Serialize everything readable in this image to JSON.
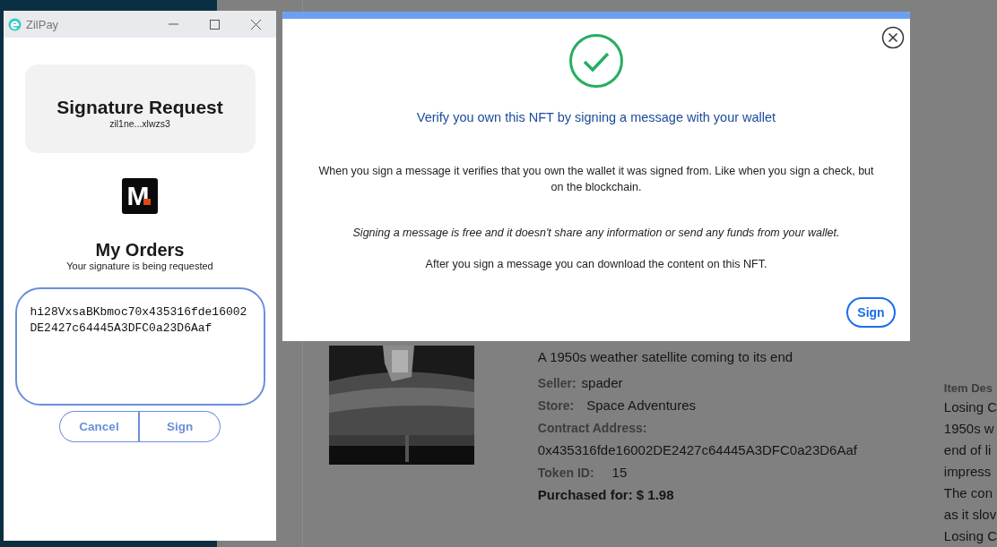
{
  "wallet_window": {
    "title": "ZilPay",
    "header_title": "Signature Request",
    "account": "zil1ne...xlwzs3",
    "logo_letter": "M",
    "app_name": "My Orders",
    "subtitle": "Your signature is being requested",
    "message": "hi28VxsaBKbmoc70x435316fde16002DE2427c64445A3DFC0a23D6Aaf",
    "buttons": [
      {
        "label": "Cancel",
        "kind": "cancel"
      },
      {
        "label": "Sign",
        "kind": "sign"
      }
    ]
  },
  "modal": {
    "title": "Verify you own this NFT by signing a message with your wallet",
    "paragraphs": [
      {
        "text": "When you sign a message it verifies that you own the wallet it was signed from. Like when you sign a check, but on the blockchain.",
        "kind": "normal"
      },
      {
        "text": "Signing a message is free and it doesn't share any information or send any funds from your wallet.",
        "kind": "italic"
      },
      {
        "text": "After you sign a message you can download the content on this NFT.",
        "kind": "normal"
      }
    ],
    "button": "Sign"
  },
  "page": {
    "tagline": "A 1950s weather satellite coming to its end",
    "details": [
      {
        "label": "Seller:",
        "value": "spader",
        "kind": "inline"
      },
      {
        "label": "Store:",
        "value": "Space Adventures",
        "kind": "inline"
      },
      {
        "label": "Contract Address:",
        "value": "0x435316fde16002DE2427c64445A3DFC0a23D6Aaf",
        "kind": "stacked"
      },
      {
        "label": "Token ID:",
        "value": "15",
        "kind": "inline"
      }
    ],
    "purchased": "Purchased for: $ 1.98",
    "description_label": "Item Des",
    "description_lines": [
      "Losing C",
      "1950s w",
      "end of li",
      "impress",
      "The con",
      "as it slov",
      "Losing C"
    ]
  }
}
